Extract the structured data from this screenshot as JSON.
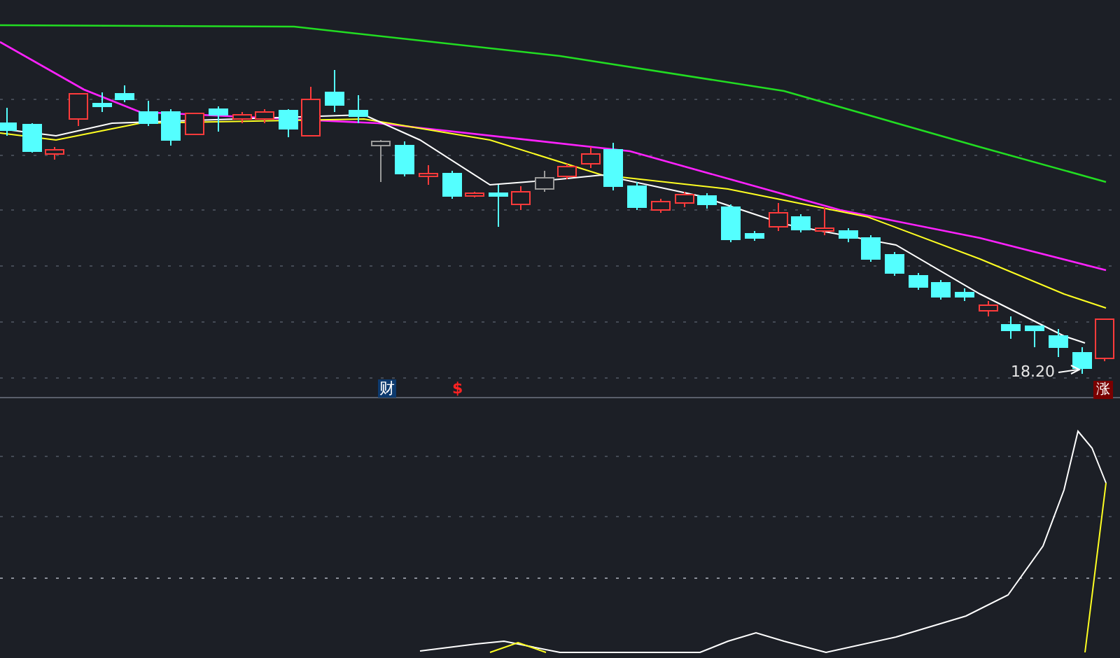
{
  "price_chart": {
    "markers": [
      {
        "kind": "finance",
        "text": "财"
      },
      {
        "kind": "dividend",
        "text": "$"
      }
    ],
    "low_price_label": "18.20",
    "badge": "涨"
  }
}
